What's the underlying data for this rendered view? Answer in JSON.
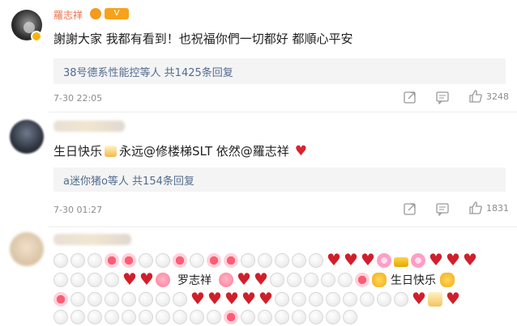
{
  "comments": [
    {
      "name": "羅志祥",
      "text": "謝謝大家 我都有看到！也祝福你們一切都好 都順心平安",
      "reply_summary": "38号德系性能控等人 共1425条回复",
      "timestamp": "7-30 22:05",
      "likes": "3248"
    },
    {
      "text_parts": [
        "生日快乐",
        "永远@修楼梯SLT 依然@羅志祥"
      ],
      "reply_summary": "a迷你猪o等人 共154条回复",
      "timestamp": "7-30 01:27",
      "likes": "1831"
    },
    {
      "inline_1": "罗志祥",
      "inline_2": "生日快乐"
    }
  ],
  "badge_text": "V",
  "colors": {
    "link": "#526c8e",
    "meta": "#8c8c8c",
    "heart": "#d6252f",
    "name": "#eb7350"
  },
  "icons": [
    "share-icon",
    "comment-icon",
    "like-icon",
    "verified-icon",
    "birthday-cake-icon",
    "heart-icon"
  ]
}
